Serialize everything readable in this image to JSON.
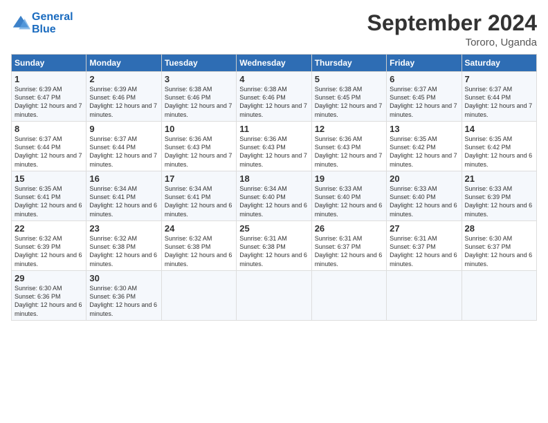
{
  "header": {
    "logo_line1": "General",
    "logo_line2": "Blue",
    "month_title": "September 2024",
    "location": "Tororo, Uganda"
  },
  "days_of_week": [
    "Sunday",
    "Monday",
    "Tuesday",
    "Wednesday",
    "Thursday",
    "Friday",
    "Saturday"
  ],
  "weeks": [
    [
      {
        "day": "1",
        "sunrise": "Sunrise: 6:39 AM",
        "sunset": "Sunset: 6:47 PM",
        "daylight": "Daylight: 12 hours and 7 minutes."
      },
      {
        "day": "2",
        "sunrise": "Sunrise: 6:39 AM",
        "sunset": "Sunset: 6:46 PM",
        "daylight": "Daylight: 12 hours and 7 minutes."
      },
      {
        "day": "3",
        "sunrise": "Sunrise: 6:38 AM",
        "sunset": "Sunset: 6:46 PM",
        "daylight": "Daylight: 12 hours and 7 minutes."
      },
      {
        "day": "4",
        "sunrise": "Sunrise: 6:38 AM",
        "sunset": "Sunset: 6:46 PM",
        "daylight": "Daylight: 12 hours and 7 minutes."
      },
      {
        "day": "5",
        "sunrise": "Sunrise: 6:38 AM",
        "sunset": "Sunset: 6:45 PM",
        "daylight": "Daylight: 12 hours and 7 minutes."
      },
      {
        "day": "6",
        "sunrise": "Sunrise: 6:37 AM",
        "sunset": "Sunset: 6:45 PM",
        "daylight": "Daylight: 12 hours and 7 minutes."
      },
      {
        "day": "7",
        "sunrise": "Sunrise: 6:37 AM",
        "sunset": "Sunset: 6:44 PM",
        "daylight": "Daylight: 12 hours and 7 minutes."
      }
    ],
    [
      {
        "day": "8",
        "sunrise": "Sunrise: 6:37 AM",
        "sunset": "Sunset: 6:44 PM",
        "daylight": "Daylight: 12 hours and 7 minutes."
      },
      {
        "day": "9",
        "sunrise": "Sunrise: 6:37 AM",
        "sunset": "Sunset: 6:44 PM",
        "daylight": "Daylight: 12 hours and 7 minutes."
      },
      {
        "day": "10",
        "sunrise": "Sunrise: 6:36 AM",
        "sunset": "Sunset: 6:43 PM",
        "daylight": "Daylight: 12 hours and 7 minutes."
      },
      {
        "day": "11",
        "sunrise": "Sunrise: 6:36 AM",
        "sunset": "Sunset: 6:43 PM",
        "daylight": "Daylight: 12 hours and 7 minutes."
      },
      {
        "day": "12",
        "sunrise": "Sunrise: 6:36 AM",
        "sunset": "Sunset: 6:43 PM",
        "daylight": "Daylight: 12 hours and 7 minutes."
      },
      {
        "day": "13",
        "sunrise": "Sunrise: 6:35 AM",
        "sunset": "Sunset: 6:42 PM",
        "daylight": "Daylight: 12 hours and 7 minutes."
      },
      {
        "day": "14",
        "sunrise": "Sunrise: 6:35 AM",
        "sunset": "Sunset: 6:42 PM",
        "daylight": "Daylight: 12 hours and 6 minutes."
      }
    ],
    [
      {
        "day": "15",
        "sunrise": "Sunrise: 6:35 AM",
        "sunset": "Sunset: 6:41 PM",
        "daylight": "Daylight: 12 hours and 6 minutes."
      },
      {
        "day": "16",
        "sunrise": "Sunrise: 6:34 AM",
        "sunset": "Sunset: 6:41 PM",
        "daylight": "Daylight: 12 hours and 6 minutes."
      },
      {
        "day": "17",
        "sunrise": "Sunrise: 6:34 AM",
        "sunset": "Sunset: 6:41 PM",
        "daylight": "Daylight: 12 hours and 6 minutes."
      },
      {
        "day": "18",
        "sunrise": "Sunrise: 6:34 AM",
        "sunset": "Sunset: 6:40 PM",
        "daylight": "Daylight: 12 hours and 6 minutes."
      },
      {
        "day": "19",
        "sunrise": "Sunrise: 6:33 AM",
        "sunset": "Sunset: 6:40 PM",
        "daylight": "Daylight: 12 hours and 6 minutes."
      },
      {
        "day": "20",
        "sunrise": "Sunrise: 6:33 AM",
        "sunset": "Sunset: 6:40 PM",
        "daylight": "Daylight: 12 hours and 6 minutes."
      },
      {
        "day": "21",
        "sunrise": "Sunrise: 6:33 AM",
        "sunset": "Sunset: 6:39 PM",
        "daylight": "Daylight: 12 hours and 6 minutes."
      }
    ],
    [
      {
        "day": "22",
        "sunrise": "Sunrise: 6:32 AM",
        "sunset": "Sunset: 6:39 PM",
        "daylight": "Daylight: 12 hours and 6 minutes."
      },
      {
        "day": "23",
        "sunrise": "Sunrise: 6:32 AM",
        "sunset": "Sunset: 6:38 PM",
        "daylight": "Daylight: 12 hours and 6 minutes."
      },
      {
        "day": "24",
        "sunrise": "Sunrise: 6:32 AM",
        "sunset": "Sunset: 6:38 PM",
        "daylight": "Daylight: 12 hours and 6 minutes."
      },
      {
        "day": "25",
        "sunrise": "Sunrise: 6:31 AM",
        "sunset": "Sunset: 6:38 PM",
        "daylight": "Daylight: 12 hours and 6 minutes."
      },
      {
        "day": "26",
        "sunrise": "Sunrise: 6:31 AM",
        "sunset": "Sunset: 6:37 PM",
        "daylight": "Daylight: 12 hours and 6 minutes."
      },
      {
        "day": "27",
        "sunrise": "Sunrise: 6:31 AM",
        "sunset": "Sunset: 6:37 PM",
        "daylight": "Daylight: 12 hours and 6 minutes."
      },
      {
        "day": "28",
        "sunrise": "Sunrise: 6:30 AM",
        "sunset": "Sunset: 6:37 PM",
        "daylight": "Daylight: 12 hours and 6 minutes."
      }
    ],
    [
      {
        "day": "29",
        "sunrise": "Sunrise: 6:30 AM",
        "sunset": "Sunset: 6:36 PM",
        "daylight": "Daylight: 12 hours and 6 minutes."
      },
      {
        "day": "30",
        "sunrise": "Sunrise: 6:30 AM",
        "sunset": "Sunset: 6:36 PM",
        "daylight": "Daylight: 12 hours and 6 minutes."
      },
      {
        "day": "",
        "sunrise": "",
        "sunset": "",
        "daylight": ""
      },
      {
        "day": "",
        "sunrise": "",
        "sunset": "",
        "daylight": ""
      },
      {
        "day": "",
        "sunrise": "",
        "sunset": "",
        "daylight": ""
      },
      {
        "day": "",
        "sunrise": "",
        "sunset": "",
        "daylight": ""
      },
      {
        "day": "",
        "sunrise": "",
        "sunset": "",
        "daylight": ""
      }
    ]
  ]
}
